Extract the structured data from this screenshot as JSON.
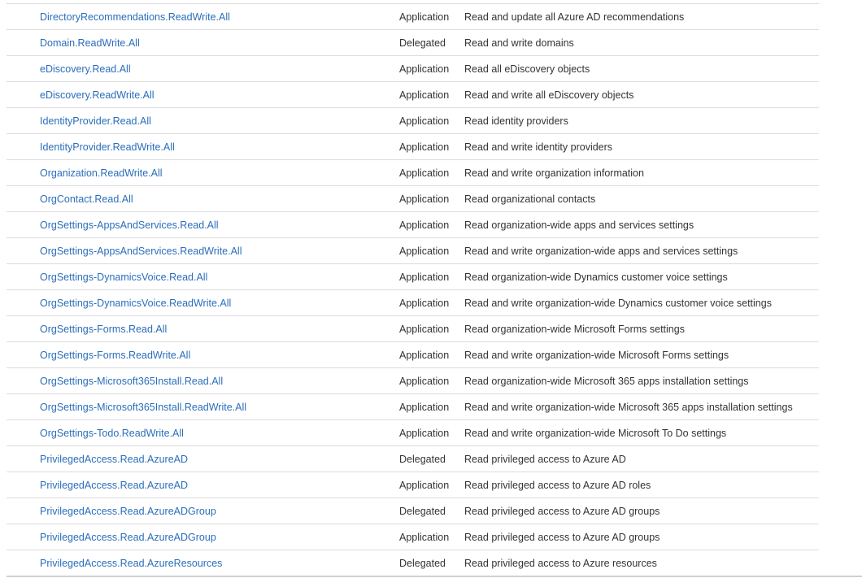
{
  "permissions": [
    {
      "name": "DirectoryRecommendations.ReadWrite.All",
      "type": "Application",
      "description": "Read and update all Azure AD recommendations"
    },
    {
      "name": "Domain.ReadWrite.All",
      "type": "Delegated",
      "description": "Read and write domains"
    },
    {
      "name": "eDiscovery.Read.All",
      "type": "Application",
      "description": "Read all eDiscovery objects"
    },
    {
      "name": "eDiscovery.ReadWrite.All",
      "type": "Application",
      "description": "Read and write all eDiscovery objects"
    },
    {
      "name": "IdentityProvider.Read.All",
      "type": "Application",
      "description": "Read identity providers"
    },
    {
      "name": "IdentityProvider.ReadWrite.All",
      "type": "Application",
      "description": "Read and write identity providers"
    },
    {
      "name": "Organization.ReadWrite.All",
      "type": "Application",
      "description": "Read and write organization information"
    },
    {
      "name": "OrgContact.Read.All",
      "type": "Application",
      "description": "Read organizational contacts"
    },
    {
      "name": "OrgSettings-AppsAndServices.Read.All",
      "type": "Application",
      "description": "Read organization-wide apps and services settings"
    },
    {
      "name": "OrgSettings-AppsAndServices.ReadWrite.All",
      "type": "Application",
      "description": "Read and write organization-wide apps and services settings"
    },
    {
      "name": "OrgSettings-DynamicsVoice.Read.All",
      "type": "Application",
      "description": "Read organization-wide Dynamics customer voice settings"
    },
    {
      "name": "OrgSettings-DynamicsVoice.ReadWrite.All",
      "type": "Application",
      "description": "Read and write organization-wide Dynamics customer voice settings"
    },
    {
      "name": "OrgSettings-Forms.Read.All",
      "type": "Application",
      "description": "Read organization-wide Microsoft Forms settings"
    },
    {
      "name": "OrgSettings-Forms.ReadWrite.All",
      "type": "Application",
      "description": "Read and write organization-wide Microsoft Forms settings"
    },
    {
      "name": "OrgSettings-Microsoft365Install.Read.All",
      "type": "Application",
      "description": "Read organization-wide Microsoft 365 apps installation settings"
    },
    {
      "name": "OrgSettings-Microsoft365Install.ReadWrite.All",
      "type": "Application",
      "description": "Read and write organization-wide Microsoft 365 apps installation settings"
    },
    {
      "name": "OrgSettings-Todo.ReadWrite.All",
      "type": "Application",
      "description": "Read and write organization-wide Microsoft To Do settings"
    },
    {
      "name": "PrivilegedAccess.Read.AzureAD",
      "type": "Delegated",
      "description": "Read privileged access to Azure AD"
    },
    {
      "name": "PrivilegedAccess.Read.AzureAD",
      "type": "Application",
      "description": "Read privileged access to Azure AD roles"
    },
    {
      "name": "PrivilegedAccess.Read.AzureADGroup",
      "type": "Delegated",
      "description": "Read privileged access to Azure AD groups"
    },
    {
      "name": "PrivilegedAccess.Read.AzureADGroup",
      "type": "Application",
      "description": "Read privileged access to Azure AD groups"
    },
    {
      "name": "PrivilegedAccess.Read.AzureResources",
      "type": "Delegated",
      "description": "Read privileged access to Azure resources"
    }
  ],
  "colors": {
    "link": "#2a6ebb",
    "text": "#333333",
    "divider": "#dcdcdc"
  }
}
